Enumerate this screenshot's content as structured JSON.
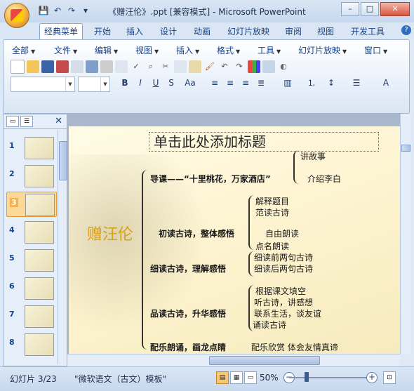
{
  "window": {
    "title": "《赠汪伦》.ppt [兼容模式] - Microsoft PowerPoint"
  },
  "ribbon_tabs": [
    "经典菜单",
    "开始",
    "插入",
    "设计",
    "动画",
    "幻灯片放映",
    "审阅",
    "视图",
    "开发工具"
  ],
  "classic_menus": [
    "全部",
    "文件",
    "编辑",
    "视图",
    "插入",
    "格式",
    "工具",
    "幻灯片放映",
    "窗口"
  ],
  "slide_panel": {
    "slide_numbers": [
      "1",
      "2",
      "3",
      "4",
      "5",
      "6",
      "7",
      "8"
    ],
    "selected_slide": "3"
  },
  "slide": {
    "title_placeholder": "单击此处添加标题",
    "poem_name": "赠汪伦",
    "sections": [
      {
        "heading": "导课——“十里桃花，万家酒店”",
        "items": [
          "讲故事",
          "介绍李白"
        ]
      },
      {
        "heading": "初读古诗，整体感悟",
        "items": [
          "解释题目",
          "范读古诗",
          "自由朗读",
          "点名朗读"
        ]
      },
      {
        "heading": "细读古诗，理解感悟",
        "items": [
          "细读前两句古诗",
          "细读后两句古诗"
        ]
      },
      {
        "heading": "品读古诗，升华感悟",
        "items": [
          "根据课文填空",
          "听古诗，讲感想",
          "联系生活，谈友谊",
          "诵读古诗"
        ]
      },
      {
        "heading": "配乐朗诵，画龙点睛",
        "items": [
          "配乐欣赏  体会友情真谛"
        ]
      }
    ]
  },
  "status": {
    "slide_info": "幻灯片 3/23",
    "theme": "\"微软语文（古文）模板\"",
    "zoom": "50%"
  }
}
